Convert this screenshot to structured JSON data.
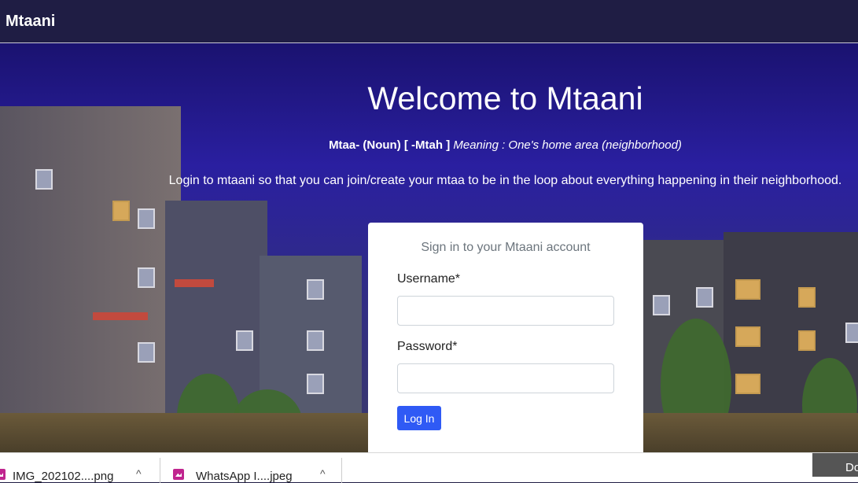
{
  "navbar": {
    "brand": "Mtaani"
  },
  "hero": {
    "title": "Welcome to Mtaani",
    "meaning_term": "Mtaa- (Noun) [ -Mtah ]",
    "meaning_definition": "Meaning : One's home area (neighborhood)",
    "intro": "Login to mtaani so that you can join/create your mtaa to be in the loop about everything happening in their neighborhood."
  },
  "login": {
    "card_title": "Sign in to your Mtaani account",
    "username_label": "Username*",
    "username_value": "",
    "password_label": "Password*",
    "password_value": "",
    "submit_label": "Log In"
  },
  "downloads_bar": {
    "items": [
      {
        "name": "IMG_202102....png",
        "icon": "image-file-icon"
      },
      {
        "name": "WhatsApp I....jpeg",
        "icon": "image-file-icon"
      }
    ],
    "show_all_label": "Do"
  }
}
